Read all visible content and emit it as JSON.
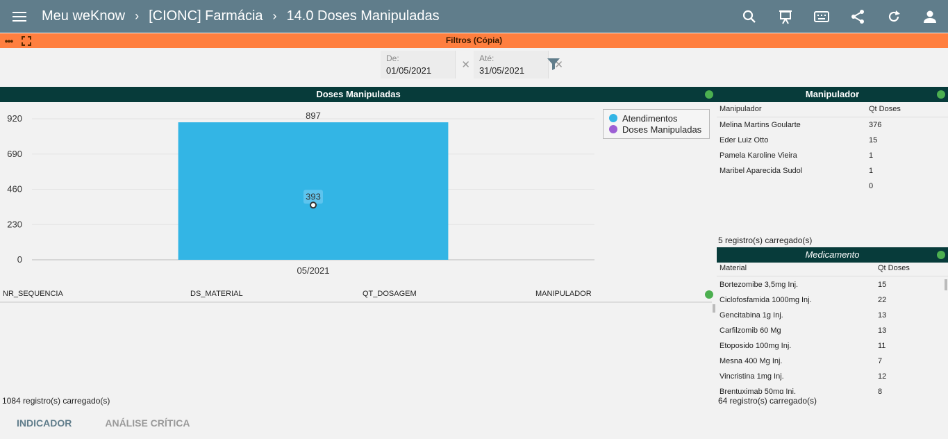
{
  "header": {
    "app_title": "Meu weKnow",
    "crumb_1": "[CIONC] Farmácia",
    "crumb_2": "14.0 Doses Manipuladas"
  },
  "filters": {
    "title": "Filtros (Cópia)",
    "from_label": "De:",
    "from_value": "01/05/2021",
    "to_label": "Até:",
    "to_value": "31/05/2021",
    "clear_glyph": "✕"
  },
  "doses_panel": {
    "title": "Doses Manipuladas",
    "legend": [
      "Atendimentos",
      "Doses Manipuladas"
    ],
    "grid_columns": [
      "NR_SEQUENCIA",
      "DS_MATERIAL",
      "QT_DOSAGEM",
      "MANIPULADOR"
    ],
    "records": "1084 registro(s) carregado(s)"
  },
  "chart_data": {
    "type": "bar",
    "categories": [
      "05/2021"
    ],
    "series": [
      {
        "name": "Atendimentos",
        "type": "bar",
        "values": [
          897
        ],
        "color": "#33b5e5"
      },
      {
        "name": "Doses Manipuladas",
        "type": "line",
        "values": [
          393
        ],
        "color": "#9c5fd4"
      }
    ],
    "yticks": [
      0,
      230,
      460,
      690,
      920
    ],
    "ylim": [
      0,
      920
    ],
    "data_labels": [
      "897",
      "393"
    ],
    "legend": "top-right",
    "grid": true
  },
  "manipulador_panel": {
    "title": "Manipulador",
    "columns": [
      "Manipulador",
      "Qt Doses"
    ],
    "rows": [
      [
        "Melina Martins Goularte",
        "376"
      ],
      [
        "Eder Luiz Otto",
        "15"
      ],
      [
        "Pamela Karoline Vieira",
        "1"
      ],
      [
        "Maribel Aparecida Sudol",
        "1"
      ],
      [
        "",
        "0"
      ]
    ],
    "records": "5 registro(s) carregado(s)"
  },
  "medicamento_panel": {
    "title": "Medicamento",
    "columns": [
      "Material",
      "Qt Doses"
    ],
    "rows": [
      [
        "Bortezomibe 3,5mg Inj.",
        "15"
      ],
      [
        "Ciclofosfamida 1000mg  Inj.",
        "22"
      ],
      [
        "Gencitabina 1g Inj.",
        "13"
      ],
      [
        "Carfilzomib 60 Mg",
        "13"
      ],
      [
        "Etoposido 100mg Inj.",
        "11"
      ],
      [
        "Mesna 400 Mg Inj.",
        "7"
      ],
      [
        "Vincristina 1mg Inj.",
        "12"
      ],
      [
        "Brentuximab 50mg Inj.",
        "8"
      ]
    ],
    "records": "64 registro(s) carregado(s)"
  },
  "tabs": [
    "INDICADOR",
    "ANÁLISE CRÍTICA"
  ],
  "colors": {
    "topbar": "#607d8b",
    "filterbar": "#ff7f3f",
    "panel_header": "#073b3a",
    "status": "#4caf50"
  }
}
